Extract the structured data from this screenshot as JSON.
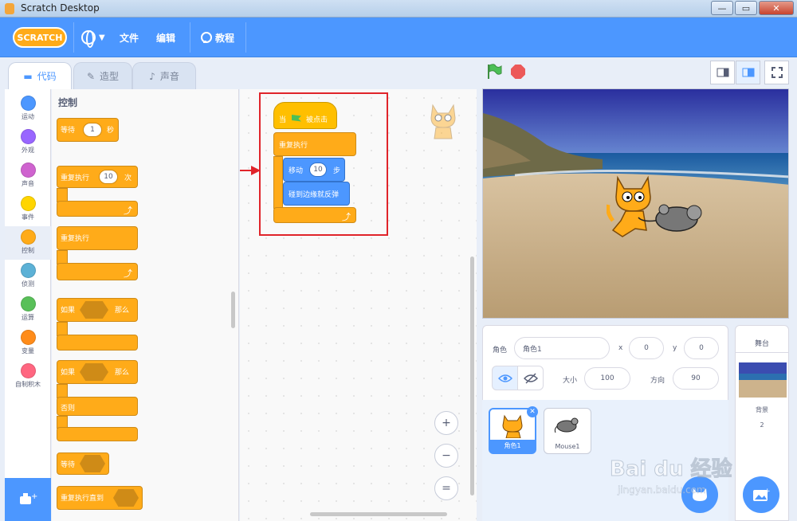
{
  "window": {
    "title": "Scratch Desktop"
  },
  "menubar": {
    "logo": "SCRATCH",
    "file": "文件",
    "edit": "编辑",
    "tutorials": "教程"
  },
  "tabs": [
    {
      "label": "代码"
    },
    {
      "label": "造型"
    },
    {
      "label": "声音"
    }
  ],
  "categories": [
    {
      "label": "运动",
      "color": "#4c97ff"
    },
    {
      "label": "外观",
      "color": "#9966ff"
    },
    {
      "label": "声音",
      "color": "#cf63cf"
    },
    {
      "label": "事件",
      "color": "#ffd500"
    },
    {
      "label": "控制",
      "color": "#ffab19"
    },
    {
      "label": "侦测",
      "color": "#5cb1d6"
    },
    {
      "label": "运算",
      "color": "#59c059"
    },
    {
      "label": "变量",
      "color": "#ff8c1a"
    },
    {
      "label": "自制积木",
      "color": "#ff6680"
    }
  ],
  "palette": {
    "title": "控制",
    "wait": {
      "label": "等待",
      "value": "1",
      "unit": "秒"
    },
    "repeat": {
      "label": "重复执行",
      "value": "10",
      "unit": "次"
    },
    "forever": {
      "label": "重复执行"
    },
    "if_then": {
      "label": "如果",
      "then": "那么"
    },
    "if_else": {
      "label": "如果",
      "then": "那么",
      "else": "否则"
    },
    "wait_until": {
      "label": "等待"
    },
    "repeat_until": {
      "label": "重复执行直到"
    }
  },
  "script": {
    "hat": {
      "label": "当",
      "suffix": "被点击"
    },
    "forever": {
      "label": "重复执行"
    },
    "move": {
      "label": "移动",
      "value": "10",
      "unit": "步"
    },
    "bounce": {
      "label": "碰到边缘就反弹"
    }
  },
  "zoom": {
    "in": "+",
    "out": "−",
    "reset": "="
  },
  "sprite_info": {
    "sprite_label": "角色",
    "sprite_name": "角色1",
    "x_label": "x",
    "x": "0",
    "y_label": "y",
    "y": "0",
    "size_label": "大小",
    "size": "100",
    "dir_label": "方向",
    "direction": "90"
  },
  "sprites": [
    {
      "name": "角色1"
    },
    {
      "name": "Mouse1"
    }
  ],
  "stage_panel": {
    "title": "舞台",
    "backdrop_label": "背景",
    "backdrop_count": "2"
  },
  "watermark": {
    "brand": "Bai du 经验",
    "url": "jingyan.baidu.com"
  },
  "colors": {
    "accent": "#4c97ff",
    "control": "#ffab19",
    "event": "#ffbf00",
    "highlight": "#e0242a"
  }
}
